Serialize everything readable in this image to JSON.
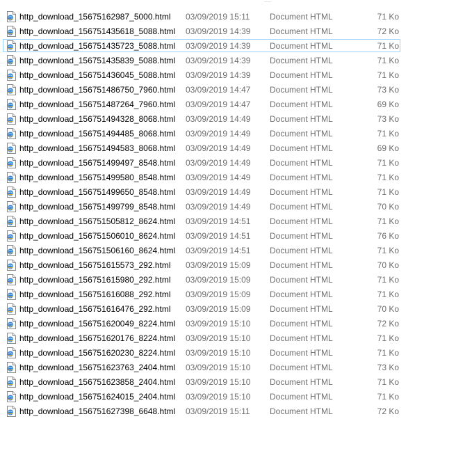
{
  "file_list": {
    "rows": [
      {
        "name": "http_download_15675162987_5000.html",
        "date": "03/09/2019 15:11",
        "type": "Document HTML",
        "size": "71 Ko",
        "selected": false
      },
      {
        "name": "http_download_156751435618_5088.html",
        "date": "03/09/2019 14:39",
        "type": "Document HTML",
        "size": "72 Ko",
        "selected": false
      },
      {
        "name": "http_download_156751435723_5088.html",
        "date": "03/09/2019 14:39",
        "type": "Document HTML",
        "size": "71 Ko",
        "selected": true
      },
      {
        "name": "http_download_156751435839_5088.html",
        "date": "03/09/2019 14:39",
        "type": "Document HTML",
        "size": "71 Ko",
        "selected": false
      },
      {
        "name": "http_download_156751436045_5088.html",
        "date": "03/09/2019 14:39",
        "type": "Document HTML",
        "size": "71 Ko",
        "selected": false
      },
      {
        "name": "http_download_156751486750_7960.html",
        "date": "03/09/2019 14:47",
        "type": "Document HTML",
        "size": "73 Ko",
        "selected": false
      },
      {
        "name": "http_download_156751487264_7960.html",
        "date": "03/09/2019 14:47",
        "type": "Document HTML",
        "size": "69 Ko",
        "selected": false
      },
      {
        "name": "http_download_156751494328_8068.html",
        "date": "03/09/2019 14:49",
        "type": "Document HTML",
        "size": "73 Ko",
        "selected": false
      },
      {
        "name": "http_download_156751494485_8068.html",
        "date": "03/09/2019 14:49",
        "type": "Document HTML",
        "size": "71 Ko",
        "selected": false
      },
      {
        "name": "http_download_156751494583_8068.html",
        "date": "03/09/2019 14:49",
        "type": "Document HTML",
        "size": "69 Ko",
        "selected": false
      },
      {
        "name": "http_download_156751499497_8548.html",
        "date": "03/09/2019 14:49",
        "type": "Document HTML",
        "size": "71 Ko",
        "selected": false
      },
      {
        "name": "http_download_156751499580_8548.html",
        "date": "03/09/2019 14:49",
        "type": "Document HTML",
        "size": "71 Ko",
        "selected": false
      },
      {
        "name": "http_download_156751499650_8548.html",
        "date": "03/09/2019 14:49",
        "type": "Document HTML",
        "size": "71 Ko",
        "selected": false
      },
      {
        "name": "http_download_156751499799_8548.html",
        "date": "03/09/2019 14:49",
        "type": "Document HTML",
        "size": "70 Ko",
        "selected": false
      },
      {
        "name": "http_download_156751505812_8624.html",
        "date": "03/09/2019 14:51",
        "type": "Document HTML",
        "size": "71 Ko",
        "selected": false
      },
      {
        "name": "http_download_156751506010_8624.html",
        "date": "03/09/2019 14:51",
        "type": "Document HTML",
        "size": "76 Ko",
        "selected": false
      },
      {
        "name": "http_download_156751506160_8624.html",
        "date": "03/09/2019 14:51",
        "type": "Document HTML",
        "size": "71 Ko",
        "selected": false
      },
      {
        "name": "http_download_156751615573_292.html",
        "date": "03/09/2019 15:09",
        "type": "Document HTML",
        "size": "70 Ko",
        "selected": false
      },
      {
        "name": "http_download_156751615980_292.html",
        "date": "03/09/2019 15:09",
        "type": "Document HTML",
        "size": "71 Ko",
        "selected": false
      },
      {
        "name": "http_download_156751616088_292.html",
        "date": "03/09/2019 15:09",
        "type": "Document HTML",
        "size": "71 Ko",
        "selected": false
      },
      {
        "name": "http_download_156751616476_292.html",
        "date": "03/09/2019 15:09",
        "type": "Document HTML",
        "size": "70 Ko",
        "selected": false
      },
      {
        "name": "http_download_156751620049_8224.html",
        "date": "03/09/2019 15:10",
        "type": "Document HTML",
        "size": "72 Ko",
        "selected": false
      },
      {
        "name": "http_download_156751620176_8224.html",
        "date": "03/09/2019 15:10",
        "type": "Document HTML",
        "size": "71 Ko",
        "selected": false
      },
      {
        "name": "http_download_156751620230_8224.html",
        "date": "03/09/2019 15:10",
        "type": "Document HTML",
        "size": "71 Ko",
        "selected": false
      },
      {
        "name": "http_download_156751623763_2404.html",
        "date": "03/09/2019 15:10",
        "type": "Document HTML",
        "size": "73 Ko",
        "selected": false
      },
      {
        "name": "http_download_156751623858_2404.html",
        "date": "03/09/2019 15:10",
        "type": "Document HTML",
        "size": "71 Ko",
        "selected": false
      },
      {
        "name": "http_download_156751624015_2404.html",
        "date": "03/09/2019 15:10",
        "type": "Document HTML",
        "size": "71 Ko",
        "selected": false
      },
      {
        "name": "http_download_156751627398_6648.html",
        "date": "03/09/2019 15:11",
        "type": "Document HTML",
        "size": "72 Ko",
        "selected": false
      }
    ],
    "icon": "html-file-icon",
    "colors": {
      "selection_border": "#99d1ff",
      "name_text": "#000000",
      "meta_text": "#6d6d6d"
    }
  }
}
